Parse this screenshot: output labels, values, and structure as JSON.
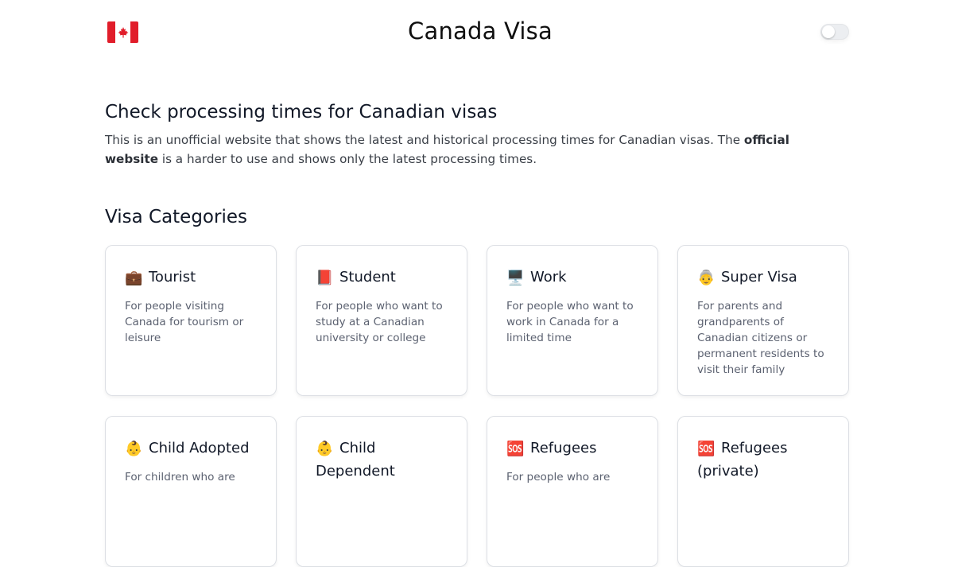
{
  "header": {
    "flag_icon": "canada-flag-icon",
    "title": "Canada Visa",
    "theme_toggle": "dark-mode-toggle"
  },
  "intro": {
    "title": "Check processing times for Canadian visas",
    "text_before_link": "This is an unofficial website that shows the latest and historical processing times for Canadian visas. The ",
    "link_text": "official website",
    "text_after_link": " is a harder to use and shows only the latest processing times."
  },
  "categories_section": {
    "title": "Visa Categories",
    "cards": [
      {
        "icon_name": "briefcase-icon",
        "icon": "💼",
        "title": "Tourist",
        "description": "For people visiting Canada for tourism or leisure"
      },
      {
        "icon_name": "book-icon",
        "icon": "📕",
        "title": "Student",
        "description": "For people who want to study at a Canadian university or college"
      },
      {
        "icon_name": "computer-icon",
        "icon": "🖥️",
        "title": "Work",
        "description": "For people who want to work in Canada for a limited time"
      },
      {
        "icon_name": "grandparent-icon",
        "icon": "👵",
        "title": "Super Visa",
        "description": "For parents and grandparents of Canadian citizens or permanent residents to visit their family"
      },
      {
        "icon_name": "child-icon",
        "icon": "👶",
        "title": "Child Adopted",
        "description": "For children who are"
      },
      {
        "icon_name": "child-icon",
        "icon": "👶",
        "title": "Child Dependent",
        "description": ""
      },
      {
        "icon_name": "sos-icon",
        "icon": "🆘",
        "title": "Refugees",
        "description": "For people who are"
      },
      {
        "icon_name": "sos-icon",
        "icon": "🆘",
        "title": "Refugees (private)",
        "description": ""
      }
    ]
  },
  "colors": {
    "flag_red": "#e11d2a",
    "text_primary": "#111827",
    "text_secondary": "#5b6170",
    "card_border": "#dcdfe4"
  }
}
